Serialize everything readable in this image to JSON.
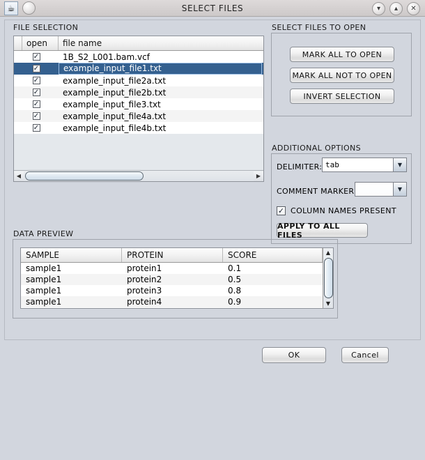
{
  "window": {
    "title": "SELECT FILES",
    "app_icon": "java-icon",
    "menu_button": "",
    "controls": {
      "minimize": "▾",
      "maximize": "▴",
      "close": "✕"
    }
  },
  "file_selection": {
    "label": "FILE SELECTION",
    "columns": [
      "open",
      "file name"
    ],
    "rows": [
      {
        "checked": true,
        "name": "1B_S2_L001.bam.vcf",
        "selected": false
      },
      {
        "checked": true,
        "name": "example_input_file1.txt",
        "selected": true
      },
      {
        "checked": true,
        "name": "example_input_file2a.txt",
        "selected": false
      },
      {
        "checked": true,
        "name": "example_input_file2b.txt",
        "selected": false
      },
      {
        "checked": true,
        "name": "example_input_file3.txt",
        "selected": false
      },
      {
        "checked": true,
        "name": "example_input_file4a.txt",
        "selected": false
      },
      {
        "checked": true,
        "name": "example_input_file4b.txt",
        "selected": false
      }
    ],
    "check_glyph": "✓",
    "scroll_left": "◀",
    "scroll_right": "▶"
  },
  "select_files_to_open": {
    "label": "SELECT FILES TO OPEN",
    "mark_all_to_open": "MARK ALL TO OPEN",
    "mark_all_not_to_open": "MARK ALL NOT TO OPEN",
    "invert_selection": "INVERT SELECTION"
  },
  "additional_options": {
    "label": "ADDITIONAL OPTIONS",
    "delimiter_label": "DELIMITER:",
    "delimiter_value": "tab",
    "comment_marker_label": "COMMENT MARKER:",
    "comment_marker_value": "",
    "column_names_label": "COLUMN NAMES PRESENT",
    "column_names_checked": true,
    "apply_to_all": "APPLY TO ALL FILES",
    "dropdown_glyph": "▼",
    "check_glyph": "✓"
  },
  "data_preview": {
    "label": "DATA PREVIEW",
    "columns": [
      "SAMPLE",
      "PROTEIN",
      "SCORE"
    ],
    "rows": [
      [
        "sample1",
        "protein1",
        "0.1"
      ],
      [
        "sample1",
        "protein2",
        "0.5"
      ],
      [
        "sample1",
        "protein3",
        "0.8"
      ],
      [
        "sample1",
        "protein4",
        "0.9"
      ]
    ],
    "scroll_up": "▲",
    "scroll_down": "▼"
  },
  "footer": {
    "ok": "OK",
    "cancel": "Cancel"
  },
  "colors": {
    "background": "#d2d6de",
    "titlebar": "#d6d2d2",
    "selection": "#34608f",
    "list_fill": "#e4e8ec"
  }
}
